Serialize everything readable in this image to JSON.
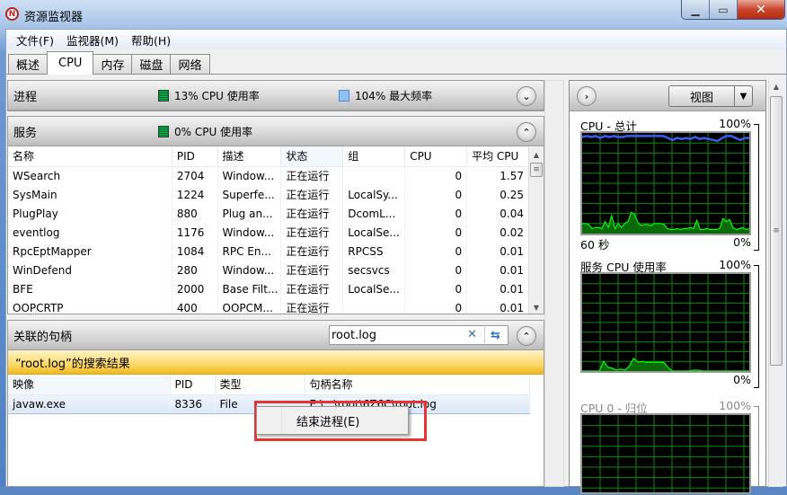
{
  "window": {
    "title": "资源监视器",
    "app_icon": "resource-monitor-icon",
    "controls": {
      "minimize": "minimize-icon",
      "maximize": "maximize-icon",
      "close": "close-icon"
    }
  },
  "menu": [
    "文件(F)",
    "监视器(M)",
    "帮助(H)"
  ],
  "tabs": [
    {
      "label": "概述",
      "active": false
    },
    {
      "label": "CPU",
      "active": true
    },
    {
      "label": "内存",
      "active": false
    },
    {
      "label": "磁盘",
      "active": false
    },
    {
      "label": "网络",
      "active": false
    }
  ],
  "processes": {
    "title": "进程",
    "cpu_usage": "13% CPU 使用率",
    "max_freq": "104% 最大频率",
    "collapse_icon": "chevron-down-icon"
  },
  "services": {
    "title": "服务",
    "cpu_usage": "0% CPU 使用率",
    "collapse_icon": "chevron-up-icon",
    "columns": [
      "名称",
      "PID",
      "描述",
      "状态",
      "组",
      "CPU",
      "平均 CPU"
    ],
    "sorted_column": "状态",
    "rows": [
      [
        "WSearch",
        "2704",
        "Window...",
        "正在运行",
        "",
        "0",
        "1.57"
      ],
      [
        "SysMain",
        "1224",
        "Superfe...",
        "正在运行",
        "LocalSy...",
        "0",
        "0.25"
      ],
      [
        "PlugPlay",
        "880",
        "Plug an...",
        "正在运行",
        "DcomL...",
        "0",
        "0.04"
      ],
      [
        "eventlog",
        "1176",
        "Window...",
        "正在运行",
        "LocalSe...",
        "0",
        "0.02"
      ],
      [
        "RpcEptMapper",
        "1084",
        "RPC En...",
        "正在运行",
        "RPCSS",
        "0",
        "0.01"
      ],
      [
        "WinDefend",
        "280",
        "Window...",
        "正在运行",
        "secsvcs",
        "0",
        "0.01"
      ],
      [
        "BFE",
        "2000",
        "Base Filt...",
        "正在运行",
        "LocalSe...",
        "0",
        "0.01"
      ],
      [
        "OOPCRTP",
        "400",
        "OOPCM...",
        "正在运行",
        "",
        "0",
        "0.01"
      ]
    ]
  },
  "handles": {
    "title": "关联的句柄",
    "search_value": "root.log",
    "clear_icon": "clear-icon",
    "search_icon": "refresh-search-icon",
    "collapse_icon": "chevron-up-icon",
    "result_banner": "“root.log”的搜索结果",
    "columns": [
      "映像",
      "PID",
      "类型",
      "句柄名称"
    ],
    "rows": [
      [
        "javaw.exe",
        "8336",
        "File",
        "E:\\...\\root\\6Z6C\\root.log"
      ]
    ]
  },
  "context_menu": {
    "items": [
      "结束进程(E)"
    ]
  },
  "right_panel": {
    "expand_icon": "chevron-right-icon",
    "view_label": "视图",
    "graphs": [
      {
        "title": "CPU - 总计",
        "max": "100%",
        "min": "0%",
        "time": "60 秒",
        "dim": false
      },
      {
        "title": "服务 CPU 使用率",
        "max": "100%",
        "min": "0%",
        "time": "",
        "dim": false
      },
      {
        "title": "CPU 0 - 归位",
        "max": "100%",
        "min": "",
        "time": "",
        "dim": true
      }
    ]
  },
  "chart_data": [
    {
      "type": "area",
      "title": "CPU - 总计",
      "ylim": [
        0,
        100
      ],
      "xlabel": "60 秒",
      "series": [
        {
          "name": "最大频率",
          "color": "#3b5cf0",
          "values": [
            96,
            97,
            96,
            97,
            95,
            97,
            96,
            97,
            96,
            96,
            97,
            97,
            97,
            97,
            97,
            97,
            97,
            97,
            97,
            95,
            93,
            95,
            94,
            95,
            94,
            96,
            94,
            95,
            94,
            93,
            92,
            95,
            97,
            97,
            95,
            93,
            95,
            95
          ]
        },
        {
          "name": "CPU 使用率",
          "color": "#00ff00",
          "values": [
            10,
            10,
            9,
            5,
            6,
            6,
            5,
            12,
            6,
            18,
            5,
            10,
            6,
            10,
            12,
            21,
            19,
            11,
            8,
            9,
            9,
            8,
            10,
            10,
            10,
            9,
            5,
            4,
            4,
            5,
            4,
            5,
            5,
            6,
            5,
            13,
            4,
            4,
            5,
            4,
            4,
            4,
            5,
            15,
            12,
            14,
            6,
            4,
            5,
            6,
            4,
            5
          ]
        }
      ]
    },
    {
      "type": "area",
      "title": "服务 CPU 使用率",
      "ylim": [
        0,
        100
      ],
      "series": [
        {
          "name": "服务 CPU 使用率",
          "color": "#00ff00",
          "values": [
            0,
            0,
            0,
            0,
            0,
            10,
            4,
            3,
            1,
            2,
            1,
            5,
            13,
            9,
            10,
            9,
            9,
            9,
            9,
            9,
            4,
            0,
            0,
            0,
            0,
            0,
            1,
            1,
            0,
            0,
            0,
            0,
            0,
            0,
            0,
            0,
            0,
            0,
            0,
            0
          ]
        }
      ]
    }
  ]
}
